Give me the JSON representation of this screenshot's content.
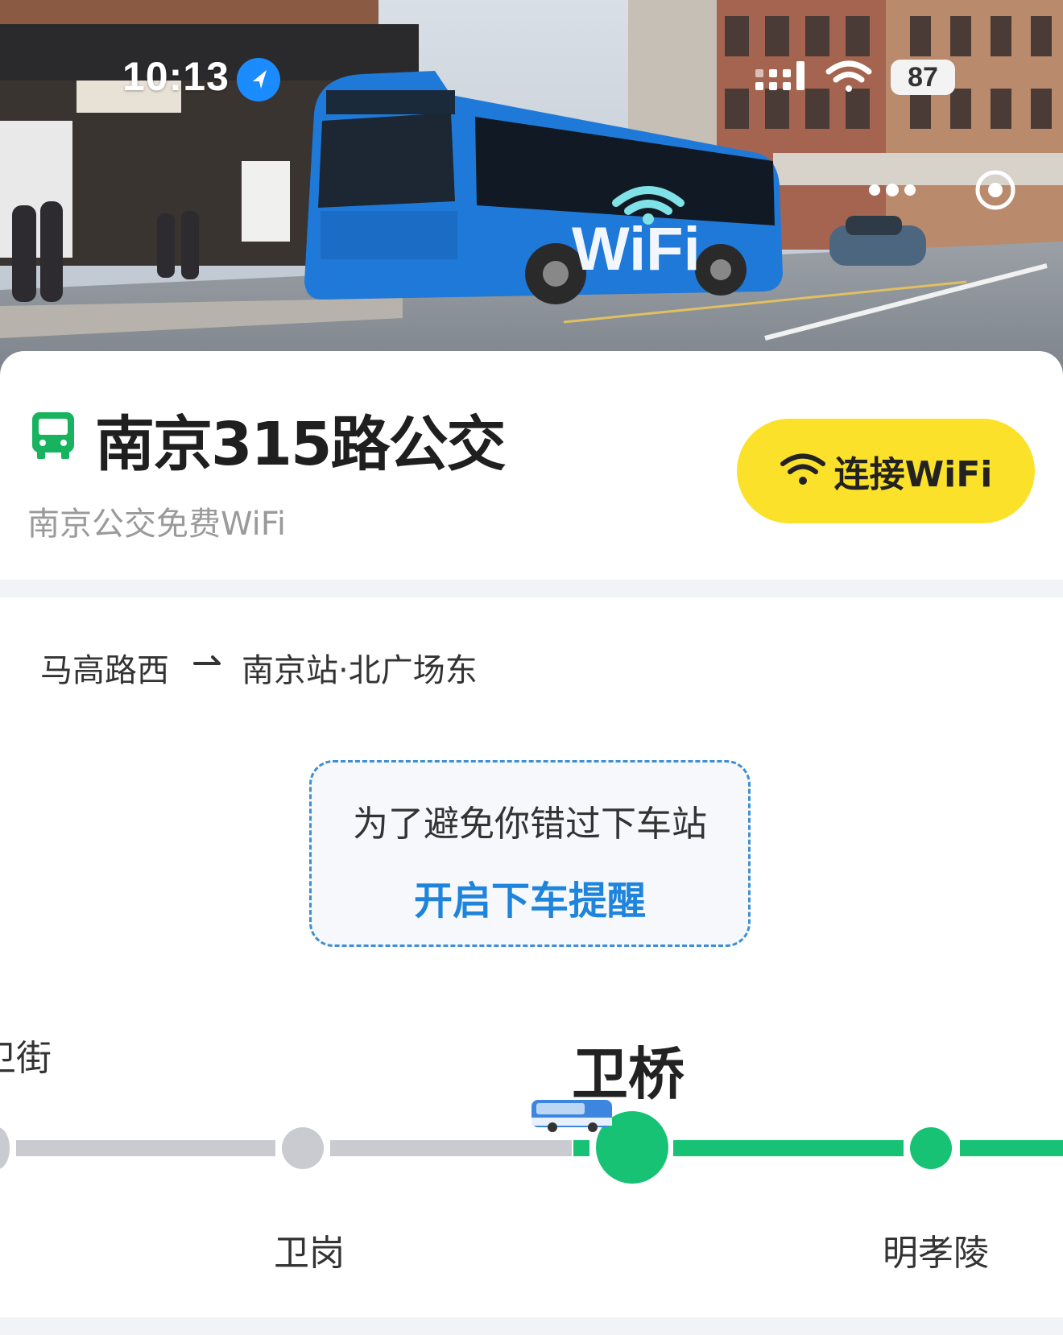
{
  "status_bar": {
    "time": "10:13",
    "battery": "87"
  },
  "hero": {
    "bus_sign_text": "WiFi"
  },
  "header": {
    "title": "南京315路公交",
    "subtitle": "南京公交免费WiFi",
    "connect_label": "连接WiFi"
  },
  "direction": {
    "from": "马高路西",
    "to": "南京站·北广场东"
  },
  "reminder": {
    "message": "为了避免你错过下车站",
    "action": "开启下车提醒"
  },
  "stops": {
    "left_partial": "卫街",
    "prev": "卫岗",
    "current": "卫桥",
    "next": "明孝陵"
  },
  "colors": {
    "accent_green": "#17c274",
    "button_yellow": "#fbe12a",
    "link_blue": "#1e84dc",
    "inactive_grey": "#c9cbd0"
  },
  "icons": [
    "location-arrow-icon",
    "cellular-signal-icon",
    "wifi-icon",
    "battery-icon",
    "more-icon",
    "target-icon",
    "bus-icon",
    "arrow-right-icon",
    "bus-marker-icon"
  ]
}
